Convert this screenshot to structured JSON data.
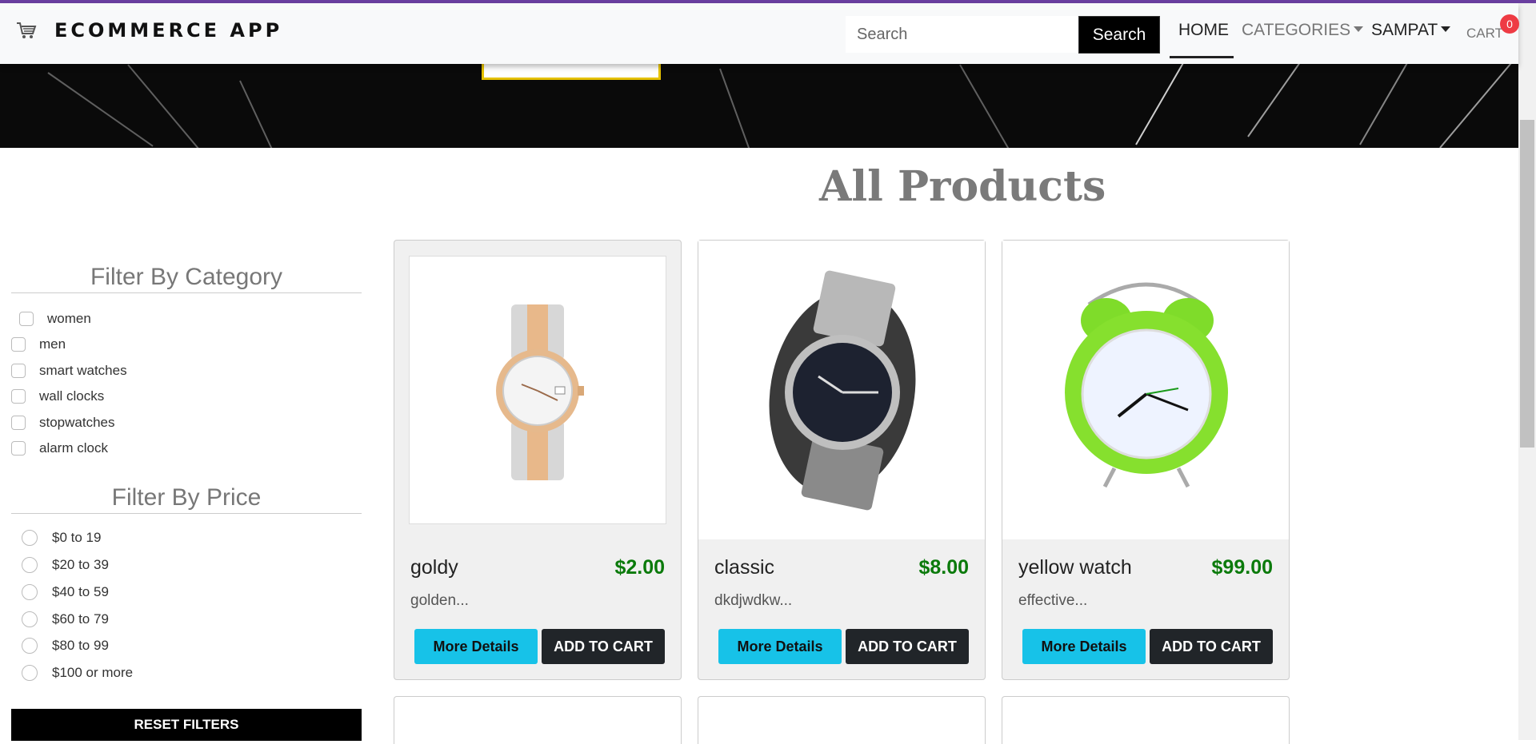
{
  "navbar": {
    "brand": "ECOMMERCE APP",
    "brand_icon": "cart-icon",
    "search_placeholder": "Search",
    "search_button": "Search",
    "links": {
      "home": "HOME",
      "categories": "CATEGORIES",
      "user": "SAMPAT",
      "cart": "CART"
    },
    "cart_count": "0"
  },
  "heading": "All Products",
  "filters": {
    "category_title": "Filter By Category",
    "categories": [
      "women",
      "men",
      "smart watches",
      "wall clocks",
      "stopwatches",
      "alarm clock"
    ],
    "price_title": "Filter By Price",
    "prices": [
      "$0 to 19",
      "$20 to 39",
      "$40 to 59",
      "$60 to 79",
      "$80 to 99",
      "$100 or more"
    ],
    "reset_label": "RESET FILTERS"
  },
  "products": [
    {
      "name": "goldy",
      "price": "$2.00",
      "desc": "golden...",
      "image_icon": "gold-watch-icon"
    },
    {
      "name": "classic",
      "price": "$8.00",
      "desc": "dkdjwdkw...",
      "image_icon": "steel-watch-icon"
    },
    {
      "name": "yellow watch",
      "price": "$99.00",
      "desc": "effective...",
      "image_icon": "alarm-clock-icon"
    }
  ],
  "buttons": {
    "more_details": "More Details",
    "add_to_cart": "ADD TO CART"
  },
  "colors": {
    "accent_cyan": "#17c2e8",
    "price_green": "#0b7a0b",
    "badge_red": "#ee3b44",
    "dark": "#212529"
  }
}
